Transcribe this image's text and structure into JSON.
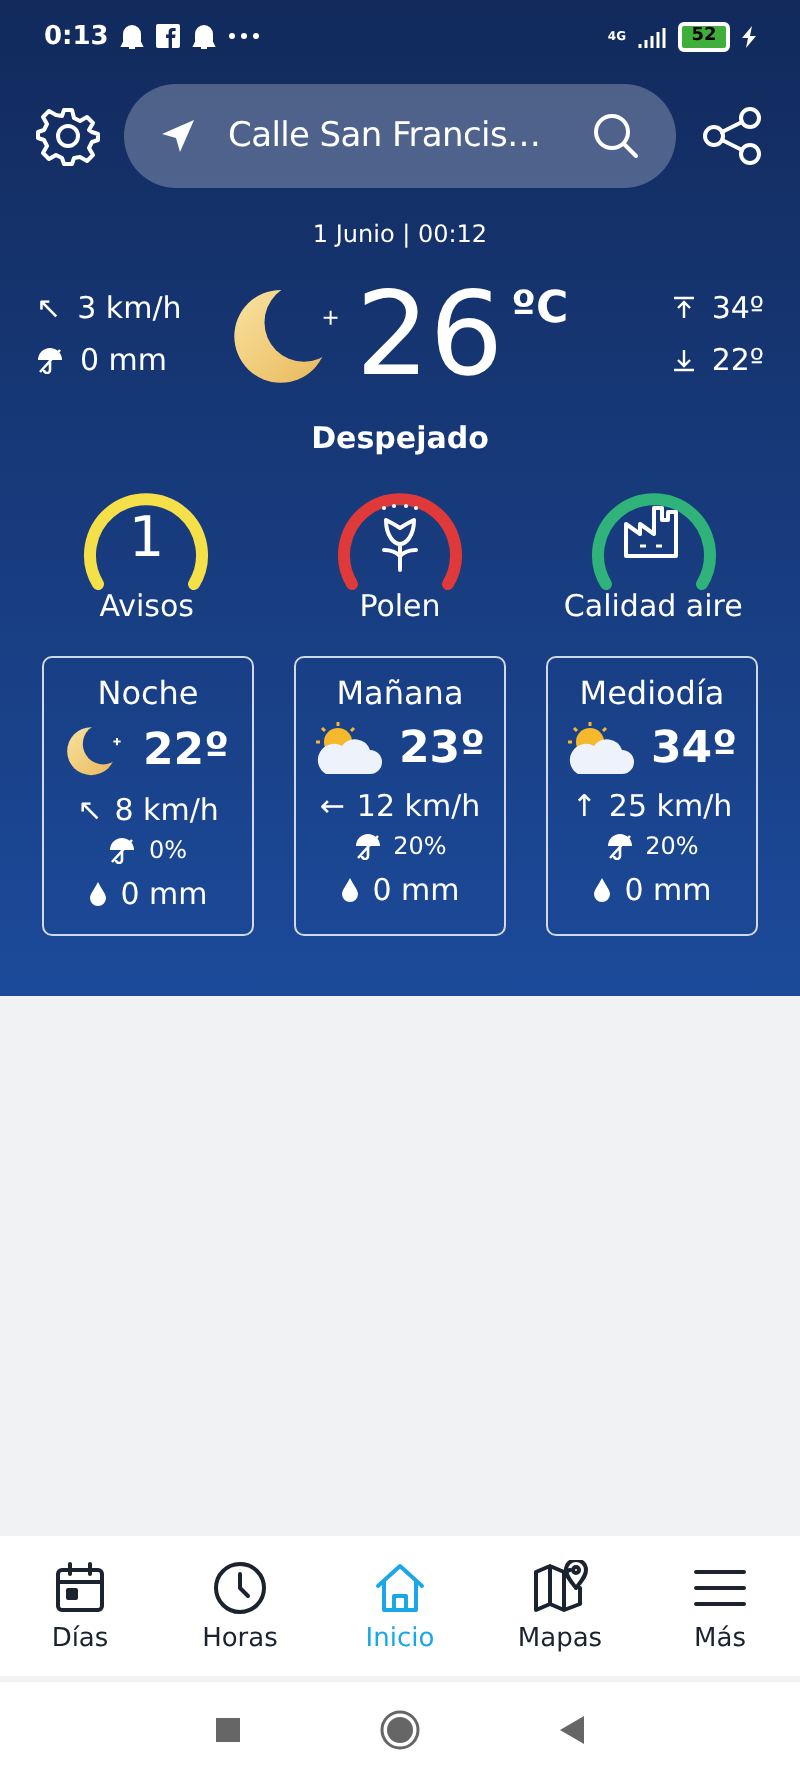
{
  "status_bar": {
    "time": "0:13",
    "network": "4G",
    "battery": "52"
  },
  "header": {
    "location": "Calle San Francis…"
  },
  "current": {
    "date": "1 Junio | 00:12",
    "wind_arrow": "↖",
    "wind": "3 km/h",
    "rain": "0 mm",
    "temperature": "26",
    "unit": "ºC",
    "max": "34º",
    "min": "22º",
    "condition": "Despejado"
  },
  "gauges": [
    {
      "kind": "number",
      "value": "1",
      "label": "Avisos",
      "color": "#f5e04a"
    },
    {
      "kind": "pollen",
      "label": "Polen",
      "color": "#e0393a"
    },
    {
      "kind": "air",
      "label": "Calidad aire",
      "color": "#2fb37a"
    }
  ],
  "periods": [
    {
      "name": "Noche",
      "kind": "moon",
      "temperature": "22º",
      "wind_arrow": "↖",
      "wind": "8 km/h",
      "rain_chance": "0%",
      "rain": "0 mm"
    },
    {
      "name": "Mañana",
      "kind": "sun-cloud",
      "temperature": "23º",
      "wind_arrow": "←",
      "wind": "12 km/h",
      "rain_chance": "20%",
      "rain": "0 mm"
    },
    {
      "name": "Mediodía",
      "kind": "sun-cloud",
      "temperature": "34º",
      "wind_arrow": "↑",
      "wind": "25 km/h",
      "rain_chance": "20%",
      "rain": "0 mm"
    }
  ],
  "nav": [
    {
      "kind": "calendar",
      "label": "Días",
      "selected": false
    },
    {
      "kind": "clock",
      "label": "Horas",
      "selected": false
    },
    {
      "kind": "home",
      "label": "Inicio",
      "selected": true
    },
    {
      "kind": "map",
      "label": "Mapas",
      "selected": false
    },
    {
      "kind": "menu",
      "label": "Más",
      "selected": false
    }
  ]
}
